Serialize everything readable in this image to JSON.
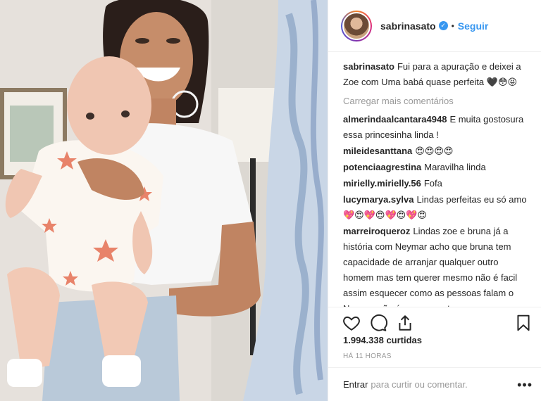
{
  "post": {
    "image_alt": "",
    "username": "sabrinasato",
    "follow_label": "Seguir",
    "separator": "•",
    "caption": "Fui para a apuração e deixei a Zoe com Uma babá quase perfeita 🖤😳😝",
    "load_more": "Carregar mais comentários",
    "likes": "1.994.338 curtidas",
    "time": "HÁ 11 HORAS",
    "enter_label": "Entrar",
    "enter_prompt": "para curtir ou comentar.",
    "more_label": "•••"
  },
  "comments": [
    {
      "user": "almerindaalcantara4948",
      "text": "E muita gostosura essa princesinha linda !"
    },
    {
      "user": "mileidesanttana",
      "text": "😍😍😍😍"
    },
    {
      "user": "potenciaagrestina",
      "text": "Maravilha linda"
    },
    {
      "user": "mirielly.mirielly.56",
      "text": "Fofa"
    },
    {
      "user": "lucymarya.sylva",
      "text": "Lindas perfeitas eu só amo 💖😍💖😍💖😍💖😍"
    },
    {
      "user": "marreiroqueroz",
      "text": "Lindas zoe e bruna já a história com Neymar acho que bruna tem capacidade de arranjar qualquer outro homem mas tem querer mesmo não é facil assim esquecer como as pessoas falam o Neymar não é esse monstro que as pessoas falam ele é só imaturo um bestalhão que não sabe conduzir a vida amorosa dele ai"
    }
  ],
  "icons": {
    "like": "heart-icon",
    "comment": "comment-icon",
    "share": "share-icon",
    "save": "bookmark-icon",
    "verified": "verified-badge-icon"
  },
  "colors": {
    "link": "#3897f0",
    "muted": "#999999",
    "text": "#262626",
    "border": "#efefef"
  }
}
